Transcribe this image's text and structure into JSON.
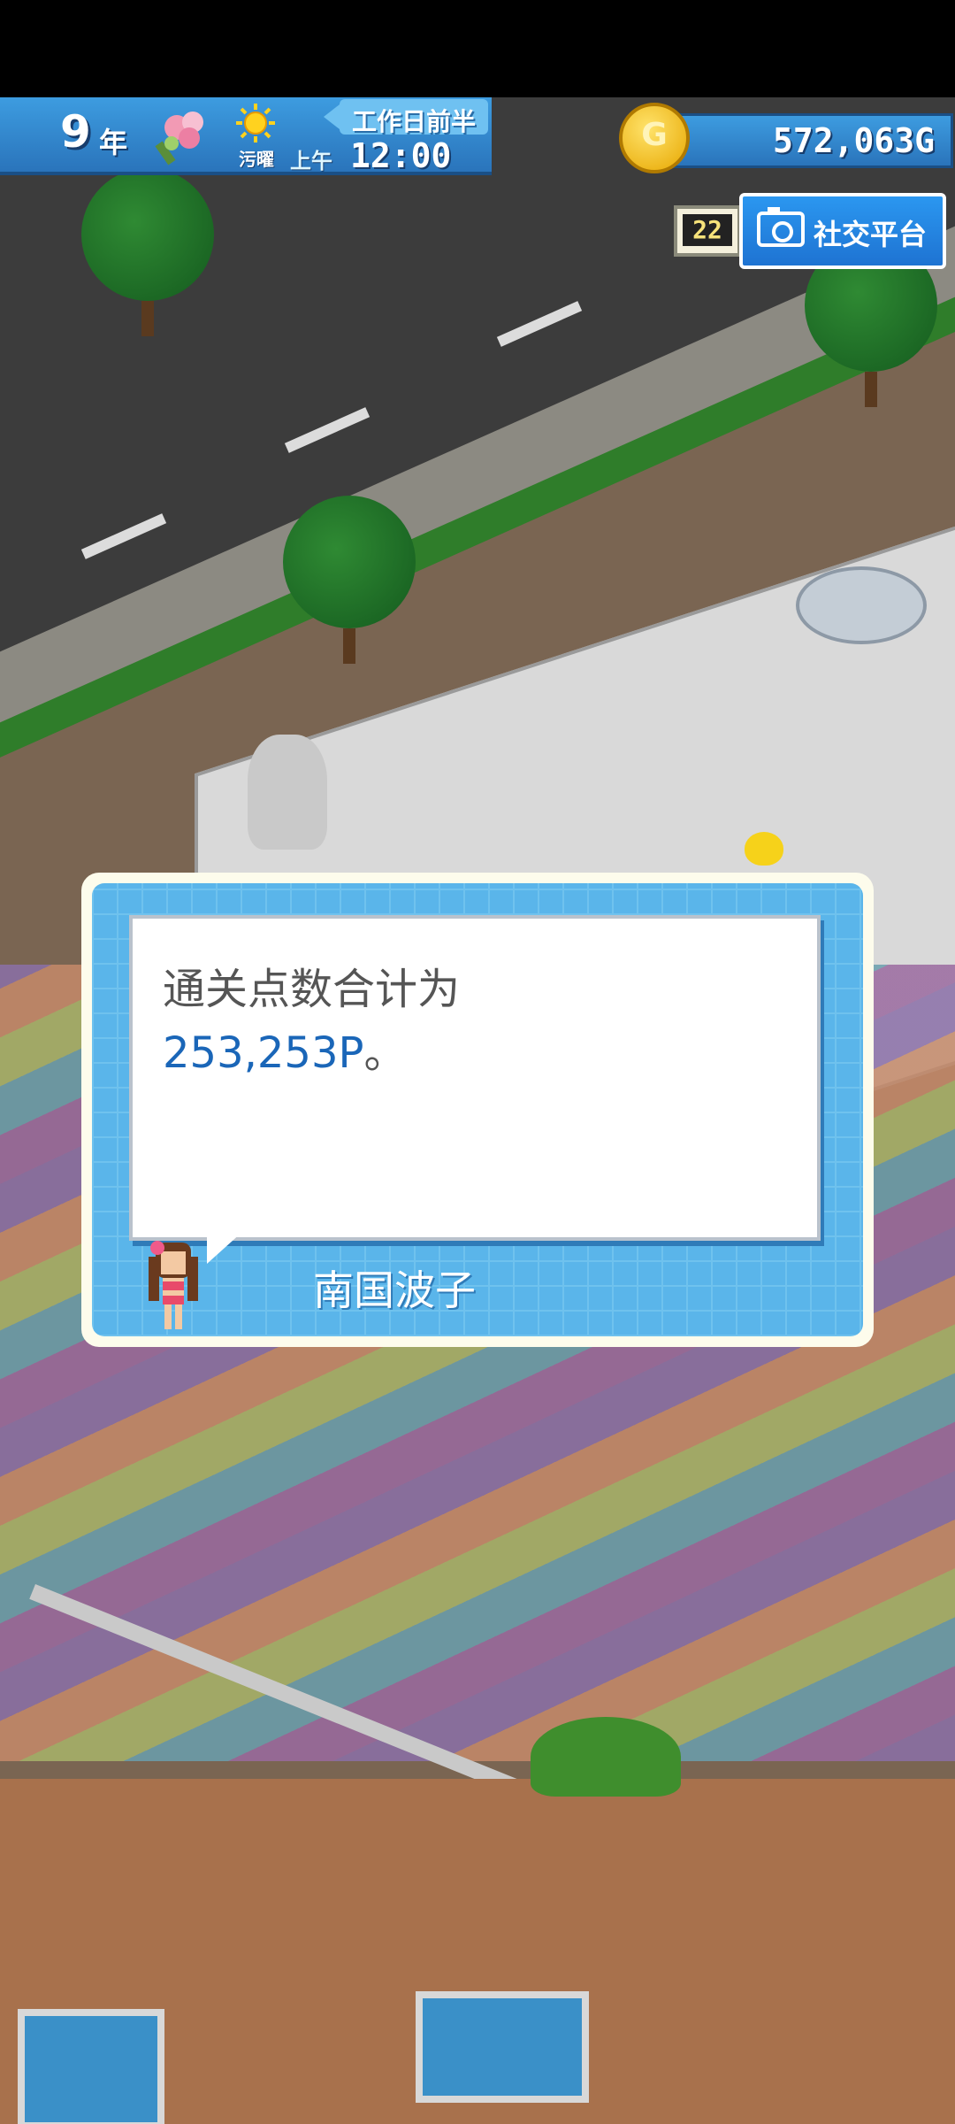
{
  "hud": {
    "year_number": "9",
    "year_label": "年",
    "season_icon": "flower-bouquet-icon",
    "weather_icon": "sun-icon",
    "weekday": "污曜",
    "ampm": "上午",
    "time": "12:00",
    "period": "工作日前半",
    "money": "572,063",
    "money_unit": "G",
    "coin_symbol": "G"
  },
  "topbar": {
    "day_badge": "22",
    "social_button_label": "社交平台"
  },
  "dialog": {
    "line1": "通关点数合计为",
    "line2_value": "253,253P",
    "line2_suffix": "。",
    "speaker_name": "南国波子"
  },
  "colors": {
    "hud_blue": "#2a74bb",
    "dialog_frame": "#5ab5ea",
    "points_text": "#1a66b8",
    "coin_gold": "#e7a700"
  }
}
